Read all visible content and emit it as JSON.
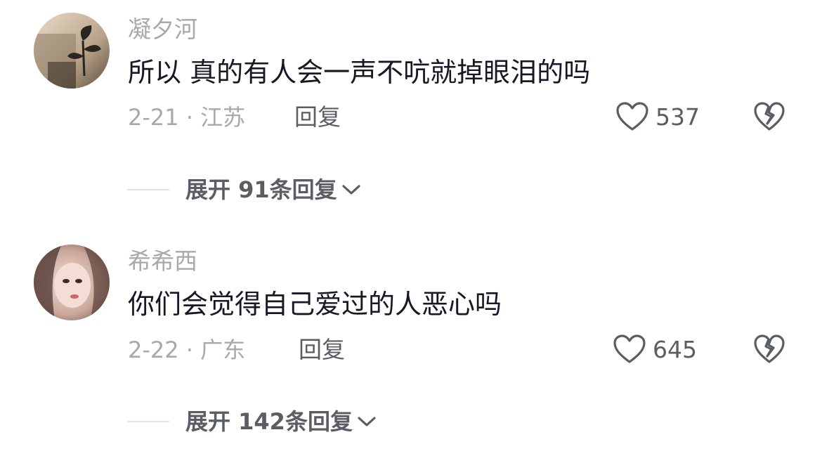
{
  "comments": [
    {
      "username": "凝夕河",
      "text": "所以 真的有人会一声不吭就掉眼泪的吗",
      "meta": "2-21 · 江苏",
      "reply_label": "回复",
      "likes": "537",
      "expand_label": "展开 91条回复",
      "avatar_icon": "plant-silhouette-avatar"
    },
    {
      "username": "希希西",
      "text": "你们会觉得自己爱过的人恶心吗",
      "meta": "2-22 · 广东",
      "reply_label": "回复",
      "likes": "645",
      "expand_label": "展开 142条回复",
      "avatar_icon": "portrait-avatar"
    }
  ],
  "icons": {
    "like": "heart-icon",
    "dislike": "broken-heart-icon",
    "expand": "chevron-down-icon"
  },
  "colors": {
    "username": "#a8a8ad",
    "text": "#161823",
    "secondary": "#5b5d64"
  }
}
